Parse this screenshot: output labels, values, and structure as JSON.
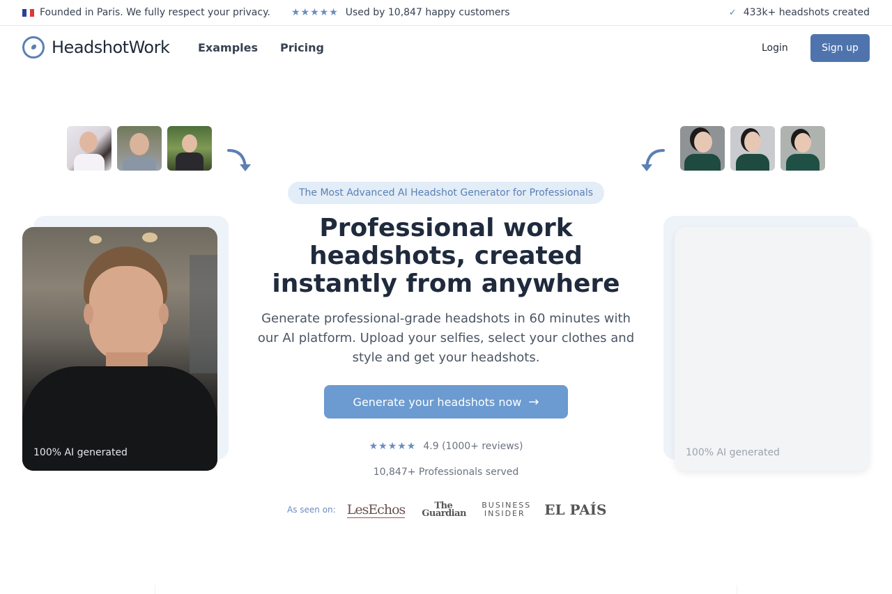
{
  "topbar": {
    "privacy_text": "Founded in Paris. We fully respect your privacy.",
    "customers_text": "Used by 10,847 happy customers",
    "headshots_text": "433k+ headshots created",
    "stars": "★★★★★"
  },
  "nav": {
    "logo": "HeadshotWork",
    "links": [
      "Examples",
      "Pricing"
    ],
    "login": "Login",
    "signup": "Sign up"
  },
  "hero": {
    "badge": "The Most Advanced AI Headshot Generator for Professionals",
    "headline_line1": "Professional work",
    "headline_line2": "headshots, created",
    "headline_line3": "instantly from anywhere",
    "subtitle": "Generate professional-grade headshots in 60 minutes with our AI platform. Upload your selfies, select your clothes and style and get your headshots.",
    "cta": "Generate your headshots now",
    "rating_stars": "★★★★★",
    "rating_text": "4.9 (1000+ reviews)",
    "served": "10,847+ Professionals served",
    "as_seen_on": "As seen on:",
    "press": [
      "LesEchos",
      "The Guardian",
      "BUSINESS INSIDER",
      "EL PAÍS"
    ]
  },
  "cards": {
    "left_label": "100% AI generated",
    "right_label": "100% AI generated"
  },
  "colors": {
    "accent": "#4f74ad",
    "cta": "#6b9bd0",
    "badge_bg": "#e3edf7"
  }
}
